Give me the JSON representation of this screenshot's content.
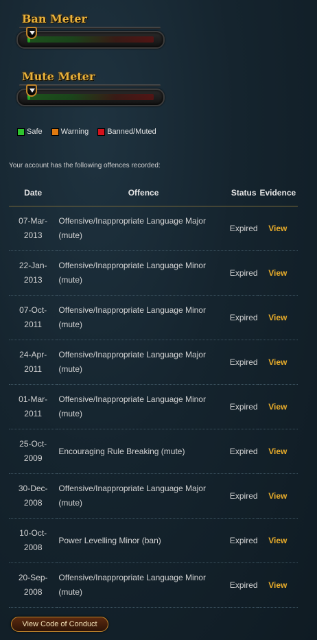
{
  "ban_meter": {
    "title": "Ban Meter",
    "level": 0
  },
  "mute_meter": {
    "title": "Mute Meter",
    "level": 0
  },
  "legend": [
    {
      "label": "Safe",
      "color": "#2fc42f"
    },
    {
      "label": "Warning",
      "color": "#e07a10"
    },
    {
      "label": "Banned/Muted",
      "color": "#d4121c"
    }
  ],
  "intro_text": "Your account has the following offences recorded:",
  "table": {
    "headers": {
      "date": "Date",
      "offence": "Offence",
      "status": "Status",
      "evidence": "Evidence"
    },
    "rows": [
      {
        "date_line1": "07-Mar-",
        "date_line2": "2013",
        "offence_line1": "Offensive/Inappropriate Language Major",
        "offence_line2": "(mute)",
        "status": "Expired",
        "evidence": "View"
      },
      {
        "date_line1": "22-Jan-",
        "date_line2": "2013",
        "offence_line1": "Offensive/Inappropriate Language Minor",
        "offence_line2": "(mute)",
        "status": "Expired",
        "evidence": "View"
      },
      {
        "date_line1": "07-Oct-",
        "date_line2": "2011",
        "offence_line1": "Offensive/Inappropriate Language Minor",
        "offence_line2": "(mute)",
        "status": "Expired",
        "evidence": "View"
      },
      {
        "date_line1": "24-Apr-",
        "date_line2": "2011",
        "offence_line1": "Offensive/Inappropriate Language Major",
        "offence_line2": "(mute)",
        "status": "Expired",
        "evidence": "View"
      },
      {
        "date_line1": "01-Mar-",
        "date_line2": "2011",
        "offence_line1": "Offensive/Inappropriate Language Minor",
        "offence_line2": "(mute)",
        "status": "Expired",
        "evidence": "View"
      },
      {
        "date_line1": "25-Oct-",
        "date_line2": "2009",
        "offence_line1": "Encouraging Rule Breaking (mute)",
        "offence_line2": "",
        "status": "Expired",
        "evidence": "View"
      },
      {
        "date_line1": "30-Dec-",
        "date_line2": "2008",
        "offence_line1": "Offensive/Inappropriate Language Major",
        "offence_line2": "(mute)",
        "status": "Expired",
        "evidence": "View"
      },
      {
        "date_line1": "10-Oct-",
        "date_line2": "2008",
        "offence_line1": "Power Levelling Minor (ban)",
        "offence_line2": "",
        "status": "Expired",
        "evidence": "View"
      },
      {
        "date_line1": "20-Sep-",
        "date_line2": "2008",
        "offence_line1": "Offensive/Inappropriate Language Minor",
        "offence_line2": "(mute)",
        "status": "Expired",
        "evidence": "View"
      }
    ]
  },
  "code_of_conduct_button": "View Code of Conduct"
}
